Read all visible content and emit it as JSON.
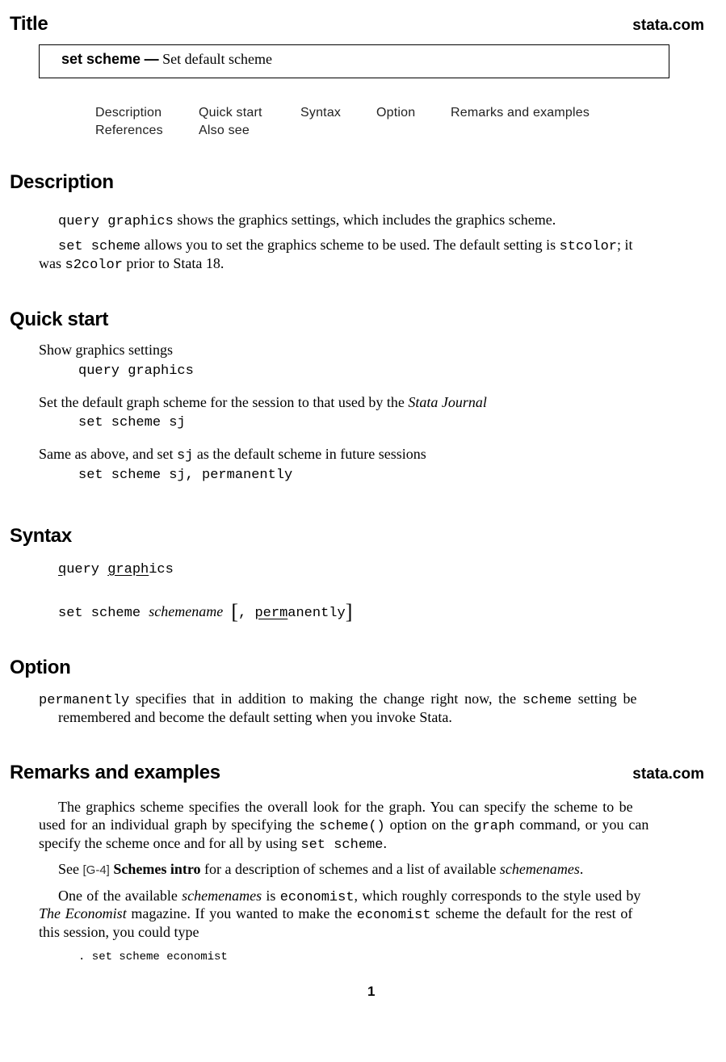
{
  "header": {
    "title": "Title",
    "site": "stata.com"
  },
  "title_box": {
    "command": "set scheme",
    "dash": "—",
    "description": "Set default scheme"
  },
  "nav": {
    "items": [
      "Description",
      "Quick start",
      "Syntax",
      "Option",
      "Remarks and examples",
      "References",
      "Also see"
    ]
  },
  "description": {
    "heading": "Description",
    "p1": {
      "code": "query graphics",
      "text": " shows the graphics settings, which includes the graphics scheme."
    },
    "p2": {
      "code1": "set scheme",
      "text1": " allows you to set the graphics scheme to be used. The default setting is ",
      "code2": "stcolor",
      "text2": "; it",
      "text3": "was ",
      "code3": "s2color",
      "text4": " prior to Stata 18."
    }
  },
  "quick_start": {
    "heading": "Quick start",
    "items": [
      {
        "desc": "Show graphics settings",
        "cmd": "query graphics"
      },
      {
        "desc_pre": "Set the default graph scheme for the session to that used by the ",
        "desc_it": "Stata Journal",
        "cmd": "set scheme sj"
      },
      {
        "desc_pre": "Same as above, and set ",
        "desc_code": "sj",
        "desc_post": " as the default scheme in future sessions",
        "cmd": "set scheme sj, permanently"
      }
    ]
  },
  "syntax": {
    "heading": "Syntax",
    "line1": {
      "u1": "q",
      "r1": "uery ",
      "u2": "graph",
      "r2": "ics"
    },
    "line2": {
      "cmd": "set scheme ",
      "arg": "schemename",
      "lbr": "[",
      "comma": ",",
      "u": "perm",
      "r": "anently",
      "rbr": "]"
    }
  },
  "option": {
    "heading": "Option",
    "name": "permanently",
    "text1": " specifies that in addition to making the change right now, the ",
    "code": "scheme",
    "text2": " setting be",
    "text3": "remembered and become the default setting when you invoke Stata."
  },
  "remarks": {
    "heading": "Remarks and examples",
    "site": "stata.com",
    "p1": {
      "line1": "The graphics scheme specifies the overall look for the graph. You can specify the scheme to be",
      "l2_pre": "used for an individual graph by specifying the ",
      "l2_code1": "scheme()",
      "l2_mid": " option on the ",
      "l2_code2": "graph",
      "l2_post": " command, or you can",
      "l3_pre": "specify the scheme once and for all by using ",
      "l3_code": "set scheme",
      "l3_post": "."
    },
    "p2": {
      "pre": "See ",
      "ref": "[G-4]",
      "link": "Schemes intro",
      "mid": " for a description of schemes and a list of available ",
      "it": "schemenames",
      "post": "."
    },
    "p3": {
      "l1_pre": "One of the available ",
      "l1_it": "schemenames",
      "l1_mid": " is ",
      "l1_code": "economist",
      "l1_post": ", which roughly corresponds to the style used by",
      "l2_it": "The Economist",
      "l2_mid": " magazine. If you wanted to make the ",
      "l2_code": "economist",
      "l2_post": " scheme the default for the rest of",
      "l3": "this session, you could type"
    },
    "example": ". set scheme economist"
  },
  "footer": {
    "page_number": "1"
  }
}
